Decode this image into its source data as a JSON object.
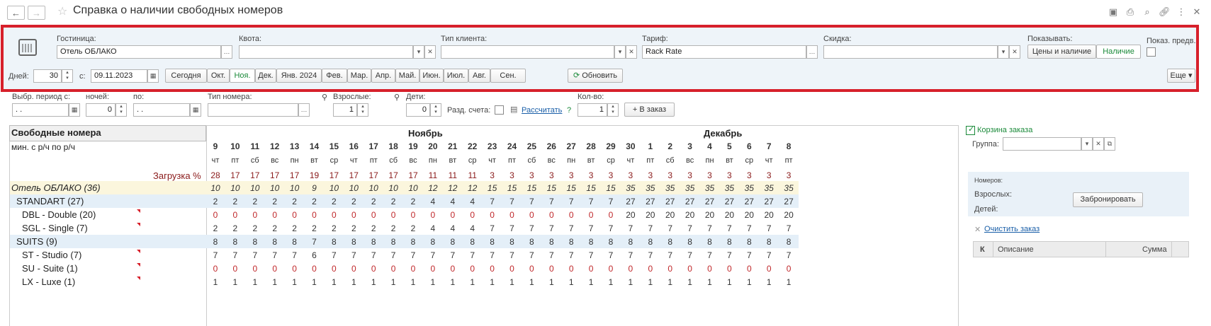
{
  "window": {
    "title": "Справка о наличии свободных номеров",
    "back_icon": "←",
    "forward_icon": "→"
  },
  "filters": {
    "hotel_label": "Гостиница:",
    "hotel_value": "Отель ОБЛАКО",
    "quota_label": "Квота:",
    "quota_value": "",
    "client_type_label": "Тип клиента:",
    "client_type_value": "",
    "tariff_label": "Тариф:",
    "tariff_value": "Rack Rate",
    "discount_label": "Скидка:",
    "discount_value": "",
    "show_label": "Показывать:",
    "show_options": [
      "Цены и наличие",
      "Наличие"
    ],
    "show_prelim_label": "Показ. предв.",
    "days_label": "Дней:",
    "days_value": "30",
    "from_label": "с:",
    "from_value": "09.11.2023",
    "period_buttons": [
      "Сегодня",
      "Окт.",
      "Ноя.",
      "Дек.",
      "Янв. 2024",
      "Фев.",
      "Мар.",
      "Апр.",
      "Май.",
      "Июн.",
      "Июл.",
      "Авг.",
      "Сен."
    ],
    "refresh_label": "Обновить",
    "more_label": "Еще"
  },
  "booking": {
    "period_from_label": "Выбр. период с:",
    "period_from_value": " .  .",
    "nights_label": "ночей:",
    "nights_value": "0",
    "to_label": "по:",
    "to_value": " .  .",
    "room_type_label": "Тип номера:",
    "room_type_value": "",
    "adults_label": "Взрослые:",
    "adults_value": "1",
    "children_label": "Дети:",
    "children_value": "0",
    "split_label": "Разд. счета:",
    "calc_label": "Рассчитать",
    "help_label": "?",
    "qty_label": "Кол-во:",
    "qty_value": "1",
    "add_to_order_label": "В заказ"
  },
  "table": {
    "header_title": "Свободные номера",
    "subheader": "мин. с р/ч по р/ч",
    "load_label": "Загрузка %",
    "month_nov": "Ноябрь",
    "month_dec": "Декабрь",
    "days": [
      "9",
      "10",
      "11",
      "12",
      "13",
      "14",
      "15",
      "16",
      "17",
      "18",
      "19",
      "20",
      "21",
      "22",
      "23",
      "24",
      "25",
      "26",
      "27",
      "28",
      "29",
      "30",
      "1",
      "2",
      "3",
      "4",
      "5",
      "6",
      "7",
      "8"
    ],
    "weekdays": [
      "чт",
      "пт",
      "сб",
      "вс",
      "пн",
      "вт",
      "ср",
      "чт",
      "пт",
      "сб",
      "вс",
      "пн",
      "вт",
      "ср",
      "чт",
      "пт",
      "сб",
      "вс",
      "пн",
      "вт",
      "ср",
      "чт",
      "пт",
      "сб",
      "вс",
      "пн",
      "вт",
      "ср",
      "чт",
      "пт"
    ],
    "load": [
      "28",
      "17",
      "17",
      "17",
      "17",
      "19",
      "17",
      "17",
      "17",
      "17",
      "17",
      "11",
      "11",
      "11",
      "3",
      "3",
      "3",
      "3",
      "3",
      "3",
      "3",
      "3",
      "3",
      "3",
      "3",
      "3",
      "3",
      "3",
      "3",
      "3"
    ],
    "rows": [
      {
        "label": "Отель ОБЛАКО (36)",
        "kind": "hotel",
        "values": [
          "10",
          "10",
          "10",
          "10",
          "10",
          "9",
          "10",
          "10",
          "10",
          "10",
          "10",
          "12",
          "12",
          "12",
          "15",
          "15",
          "15",
          "15",
          "15",
          "15",
          "15",
          "35",
          "35",
          "35",
          "35",
          "35",
          "35",
          "35",
          "35",
          "35"
        ]
      },
      {
        "label": "STANDART (27)",
        "kind": "group",
        "values": [
          "2",
          "2",
          "2",
          "2",
          "2",
          "2",
          "2",
          "2",
          "2",
          "2",
          "2",
          "4",
          "4",
          "4",
          "7",
          "7",
          "7",
          "7",
          "7",
          "7",
          "7",
          "27",
          "27",
          "27",
          "27",
          "27",
          "27",
          "27",
          "27",
          "27"
        ]
      },
      {
        "label": "DBL - Double (20)",
        "kind": "room",
        "values": [
          "0",
          "0",
          "0",
          "0",
          "0",
          "0",
          "0",
          "0",
          "0",
          "0",
          "0",
          "0",
          "0",
          "0",
          "0",
          "0",
          "0",
          "0",
          "0",
          "0",
          "0",
          "20",
          "20",
          "20",
          "20",
          "20",
          "20",
          "20",
          "20",
          "20"
        ]
      },
      {
        "label": "SGL - Single (7)",
        "kind": "room",
        "values": [
          "2",
          "2",
          "2",
          "2",
          "2",
          "2",
          "2",
          "2",
          "2",
          "2",
          "2",
          "4",
          "4",
          "4",
          "7",
          "7",
          "7",
          "7",
          "7",
          "7",
          "7",
          "7",
          "7",
          "7",
          "7",
          "7",
          "7",
          "7",
          "7",
          "7"
        ]
      },
      {
        "label": "SUITS (9)",
        "kind": "group",
        "values": [
          "8",
          "8",
          "8",
          "8",
          "8",
          "7",
          "8",
          "8",
          "8",
          "8",
          "8",
          "8",
          "8",
          "8",
          "8",
          "8",
          "8",
          "8",
          "8",
          "8",
          "8",
          "8",
          "8",
          "8",
          "8",
          "8",
          "8",
          "8",
          "8",
          "8"
        ]
      },
      {
        "label": "ST - Studio (7)",
        "kind": "room",
        "values": [
          "7",
          "7",
          "7",
          "7",
          "7",
          "6",
          "7",
          "7",
          "7",
          "7",
          "7",
          "7",
          "7",
          "7",
          "7",
          "7",
          "7",
          "7",
          "7",
          "7",
          "7",
          "7",
          "7",
          "7",
          "7",
          "7",
          "7",
          "7",
          "7",
          "7"
        ]
      },
      {
        "label": "SU - Suite (1)",
        "kind": "room",
        "values": [
          "0",
          "0",
          "0",
          "0",
          "0",
          "0",
          "0",
          "0",
          "0",
          "0",
          "0",
          "0",
          "0",
          "0",
          "0",
          "0",
          "0",
          "0",
          "0",
          "0",
          "0",
          "0",
          "0",
          "0",
          "0",
          "0",
          "0",
          "0",
          "0",
          "0"
        ]
      },
      {
        "label": "LX - Luxe (1)",
        "kind": "room",
        "values": [
          "1",
          "1",
          "1",
          "1",
          "1",
          "1",
          "1",
          "1",
          "1",
          "1",
          "1",
          "1",
          "1",
          "1",
          "1",
          "1",
          "1",
          "1",
          "1",
          "1",
          "1",
          "1",
          "1",
          "1",
          "1",
          "1",
          "1",
          "1",
          "1",
          "1"
        ]
      }
    ]
  },
  "cart": {
    "cart_label": "Корзина заказа",
    "group_label": "Группа:",
    "group_value": "",
    "rooms_label": "Номеров:",
    "adults_label": "Взрослых:",
    "children_label": "Детей:",
    "book_button": "Забронировать",
    "clear_label": "Очистить заказ",
    "col_k": "К",
    "col_desc": "Описание",
    "col_sum": "Сумма"
  },
  "colors": {
    "accent_green": "#1b8a3a",
    "highlight_red": "#d7202b",
    "hotel_row_bg": "#fbf6dd",
    "group_row_bg": "#e4eff8",
    "zero_red": "#c0282b"
  }
}
